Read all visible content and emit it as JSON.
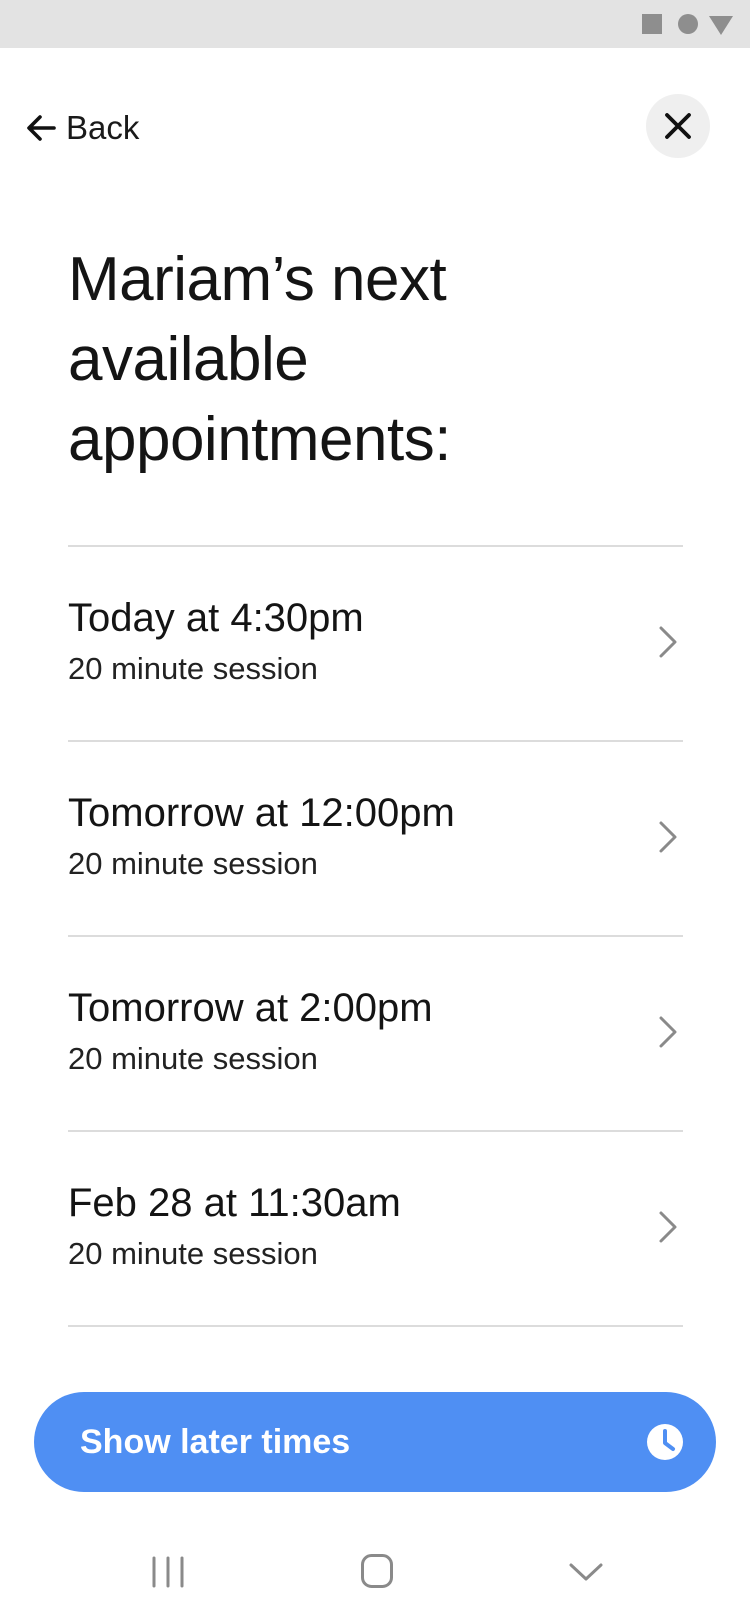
{
  "header": {
    "back_label": "Back"
  },
  "page": {
    "title": "Mariam’s next available appointments:"
  },
  "slots": [
    {
      "time": "Today at 4:30pm",
      "duration": "20 minute session"
    },
    {
      "time": "Tomorrow at 12:00pm",
      "duration": "20 minute session"
    },
    {
      "time": "Tomorrow at 2:00pm",
      "duration": "20 minute session"
    },
    {
      "time": "Feb 28 at 11:30am",
      "duration": "20 minute session"
    }
  ],
  "actions": {
    "show_later_label": "Show later times"
  },
  "icons": {
    "back": "arrow-left-icon",
    "close": "close-icon",
    "row": "chevron-right-icon",
    "later": "clock-icon"
  },
  "colors": {
    "accent": "#4f8ff3",
    "divider": "#dcdcdc",
    "close_bg": "#efefef",
    "status_bar": "#e3e3e3"
  }
}
